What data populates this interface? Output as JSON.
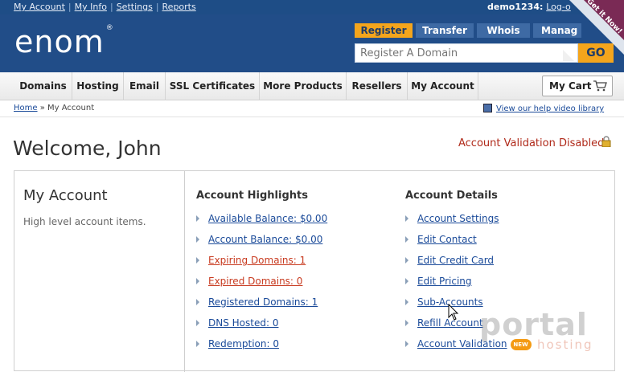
{
  "topbar": {
    "links": [
      "My Account",
      "My Info",
      "Settings",
      "Reports"
    ],
    "username": "demo1234:",
    "logout": "Log-o"
  },
  "header": {
    "logo_text": "enom",
    "logo_reg": "®",
    "domain_tabs": [
      "Register",
      "Transfer",
      "Whois",
      "Manag"
    ],
    "domain_placeholder": "Register A Domain",
    "go_label": "GO",
    "corner_banner": "Get it Now!"
  },
  "nav": {
    "items": [
      "Domains",
      "Hosting",
      "Email",
      "SSL Certificates",
      "More Products",
      "Resellers",
      "My Account"
    ],
    "cart_label": "My Cart"
  },
  "breadcrumb": {
    "home": "Home",
    "separator": "»",
    "current": "My Account",
    "help_link": "View our help video library"
  },
  "page": {
    "welcome": "Welcome, John",
    "validation_status": "Account Validation Disabled"
  },
  "panel": {
    "title": "My Account",
    "subtitle": "High level account items.",
    "highlights": {
      "title": "Account Highlights",
      "items": [
        {
          "label": "Available Balance: $0.00",
          "status": "normal"
        },
        {
          "label": "Account Balance: $0.00",
          "status": "normal"
        },
        {
          "label": "Expiring Domains: 1",
          "status": "warning"
        },
        {
          "label": "Expired Domains: 0",
          "status": "warning"
        },
        {
          "label": "Registered Domains: 1",
          "status": "normal"
        },
        {
          "label": "DNS Hosted: 0",
          "status": "normal"
        },
        {
          "label": "Redemption: 0",
          "status": "normal"
        }
      ]
    },
    "details": {
      "title": "Account Details",
      "items": [
        {
          "label": "Account Settings"
        },
        {
          "label": "Edit Contact"
        },
        {
          "label": "Edit Credit Card"
        },
        {
          "label": "Edit Pricing"
        },
        {
          "label": "Sub-Accounts"
        },
        {
          "label": "Refill Account"
        },
        {
          "label": "Account Validation",
          "badge": "NEW"
        }
      ]
    }
  },
  "watermark": {
    "line1": "portal",
    "line2": "hosting"
  },
  "colors": {
    "header": "#214d88",
    "accent": "#f4a51c",
    "link": "#1a4a99",
    "alert": "#c83a1f"
  }
}
